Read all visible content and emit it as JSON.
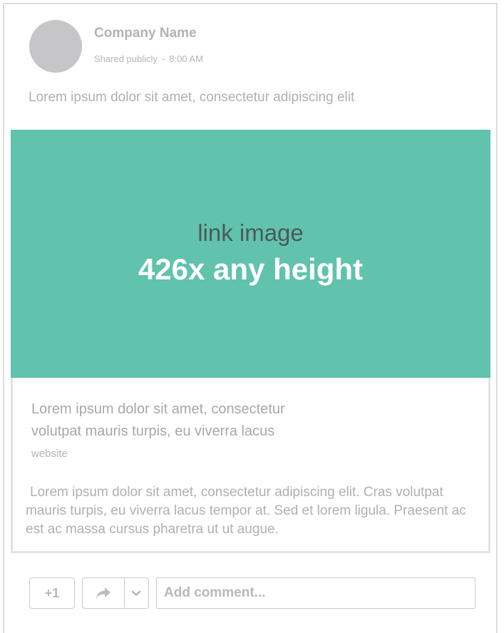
{
  "post": {
    "author": "Company Name",
    "visibility": "Shared publicly",
    "separator": "-",
    "time": "8:00 AM",
    "text": "Lorem ipsum dolor sit amet, consectetur adipiscing elit"
  },
  "link": {
    "image_line1": "link image",
    "image_line2": "426x any height",
    "title": "Lorem ipsum dolor sit amet, consectetur volutpat mauris turpis, eu viverra lacus",
    "domain": "website",
    "description": "Lorem ipsum dolor sit amet, consectetur adipiscing elit. Cras volutpat mauris turpis, eu viverra lacus tempor at. Sed et lorem ligula. Praesent ac est ac massa cursus pharetra ut ut augue."
  },
  "actions": {
    "plus_one_label": "+1",
    "share_icon": "share-arrow-icon",
    "dropdown_icon": "chevron-down-icon",
    "comment_placeholder": "Add comment..."
  },
  "colors": {
    "link_image_bg": "#61c2ad",
    "avatar": "#c6c6c8"
  }
}
